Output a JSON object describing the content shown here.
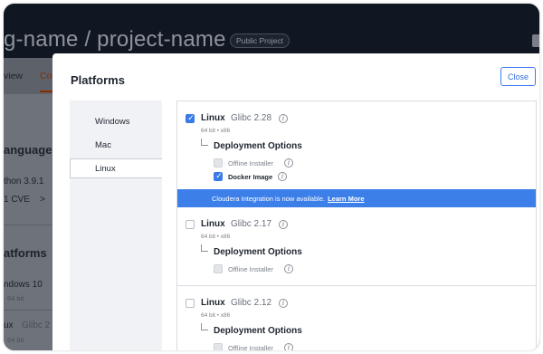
{
  "background": {
    "header_title": "g-name / project-name",
    "badge": "Public Project",
    "tabs": [
      "view",
      "Co"
    ],
    "sections": {
      "language_heading": "anguage",
      "language_value": "thon 3.9.1",
      "cve_count": "1 CVE",
      "cve_chevron": ">",
      "platforms_heading": "atforms",
      "platform_1": "ndows 10",
      "platform_1_arch": "64 bit",
      "platform_2": "ux",
      "platform_2_ver": "Glibc 2",
      "platform_2_arch": "64 bit"
    }
  },
  "modal": {
    "title": "Platforms",
    "close_label": "Close",
    "nav": [
      "Windows",
      "Mac",
      "Linux"
    ],
    "deployment_options_title": "Deployment Options",
    "offline_installer": "Offline Installer",
    "docker_image": "Docker Image",
    "banner_text": "Cloudera Integration is now available.",
    "banner_link": "Learn More",
    "platforms": [
      {
        "name": "Linux",
        "version": "Glibc 2.28",
        "arch": "64 bit • x86",
        "selected": true
      },
      {
        "name": "Linux",
        "version": "Glibc 2.17",
        "arch": "64 bit • x86",
        "selected": false
      },
      {
        "name": "Linux",
        "version": "Glibc 2.12",
        "arch": "64 bit • x86",
        "selected": false
      }
    ]
  },
  "colors": {
    "accent": "#3a7be8",
    "header_bg": "#101722",
    "overlay": "#6e727a"
  },
  "icons": {
    "info": "info-icon",
    "check": "check-icon",
    "elbow": "tree-elbow-icon"
  }
}
